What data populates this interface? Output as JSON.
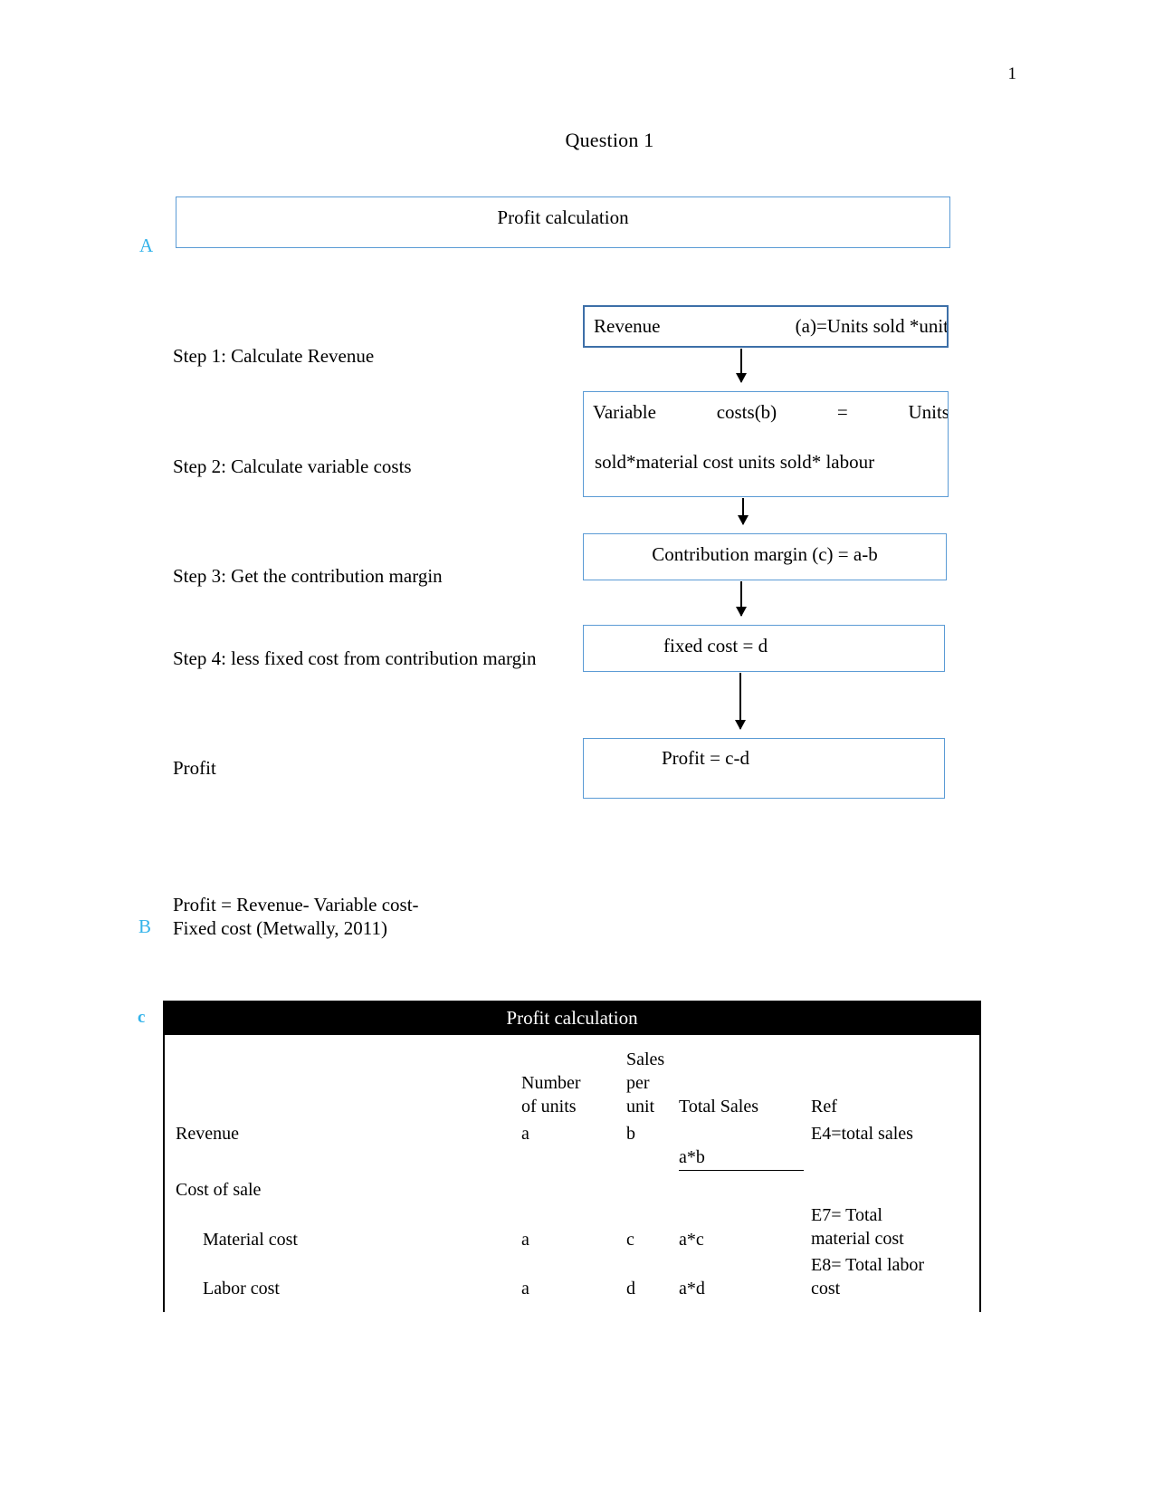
{
  "page": {
    "number": "1",
    "title": "Question 1"
  },
  "markers": {
    "a": "A",
    "b": "B",
    "c": "c"
  },
  "banner": {
    "label": "Profit calculation"
  },
  "flowchart": {
    "steps": [
      {
        "label": "Step 1: Calculate Revenue"
      },
      {
        "label": "Step 2: Calculate variable costs"
      },
      {
        "label": "Step 3: Get the contribution margin"
      },
      {
        "label": "Step 4: less fixed cost from contribution margin"
      },
      {
        "label": "Profit"
      }
    ],
    "boxes": {
      "revenue": {
        "left": "Revenue",
        "right": "(a)=Units  sold  *unit"
      },
      "variable_cost": {
        "line1_left": "Variable",
        "line1_mid": "costs(b)",
        "line1_eq": "=",
        "line1_right": "Units",
        "line2": "sold*material  cost  units  sold*  labour"
      },
      "contribution": {
        "text": "Contribution margin (c) = a-b"
      },
      "fixed_cost": {
        "text": "fixed cost = d"
      },
      "profit": {
        "text": "Profit = c-d"
      }
    }
  },
  "formula": {
    "line1": "Profit = Revenue- Variable cost-",
    "line2": "Fixed cost (Metwally, 2011)"
  },
  "table": {
    "title": "Profit calculation",
    "headers": {
      "number_of_units": "Number\nof units",
      "sales_per_unit": "Sales\nper\nunit",
      "total_sales": "Total Sales",
      "ref": "Ref"
    },
    "rows": [
      {
        "label": "Revenue",
        "units": "a",
        "per_unit": "b",
        "total": "a*b",
        "ref": "E4=total sales"
      },
      {
        "label": "Cost of sale",
        "units": "",
        "per_unit": "",
        "total": "",
        "ref": ""
      },
      {
        "label": "Material cost",
        "units": "a",
        "per_unit": "c",
        "total": "a*c",
        "ref": "E7= Total\nmaterial cost"
      },
      {
        "label": "Labor cost",
        "units": "a",
        "per_unit": "d",
        "total": "a*d",
        "ref": "E8= Total labor\ncost"
      }
    ]
  },
  "colors": {
    "marker": "#34B3EA",
    "box_border": "#5B9BD5",
    "box_border_strong": "#3D6FA8",
    "table_header_bg": "#000000"
  }
}
